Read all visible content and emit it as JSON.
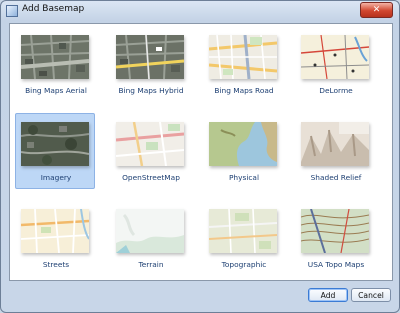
{
  "window": {
    "title": "Add Basemap",
    "close_glyph": "✕"
  },
  "basemaps": [
    {
      "label": "Bing Maps Aerial",
      "style": "aerial"
    },
    {
      "label": "Bing Maps Hybrid",
      "style": "hybrid"
    },
    {
      "label": "Bing Maps Road",
      "style": "road"
    },
    {
      "label": "DeLorme",
      "style": "delorme"
    },
    {
      "label": "Imagery",
      "style": "imagery",
      "selected": true
    },
    {
      "label": "OpenStreetMap",
      "style": "osm"
    },
    {
      "label": "Physical",
      "style": "physical"
    },
    {
      "label": "Shaded Relief",
      "style": "relief"
    },
    {
      "label": "Streets",
      "style": "streets"
    },
    {
      "label": "Terrain",
      "style": "terrain"
    },
    {
      "label": "Topographic",
      "style": "topographic"
    },
    {
      "label": "USA Topo Maps",
      "style": "usatopo"
    }
  ],
  "buttons": {
    "add": "Add",
    "cancel": "Cancel"
  }
}
